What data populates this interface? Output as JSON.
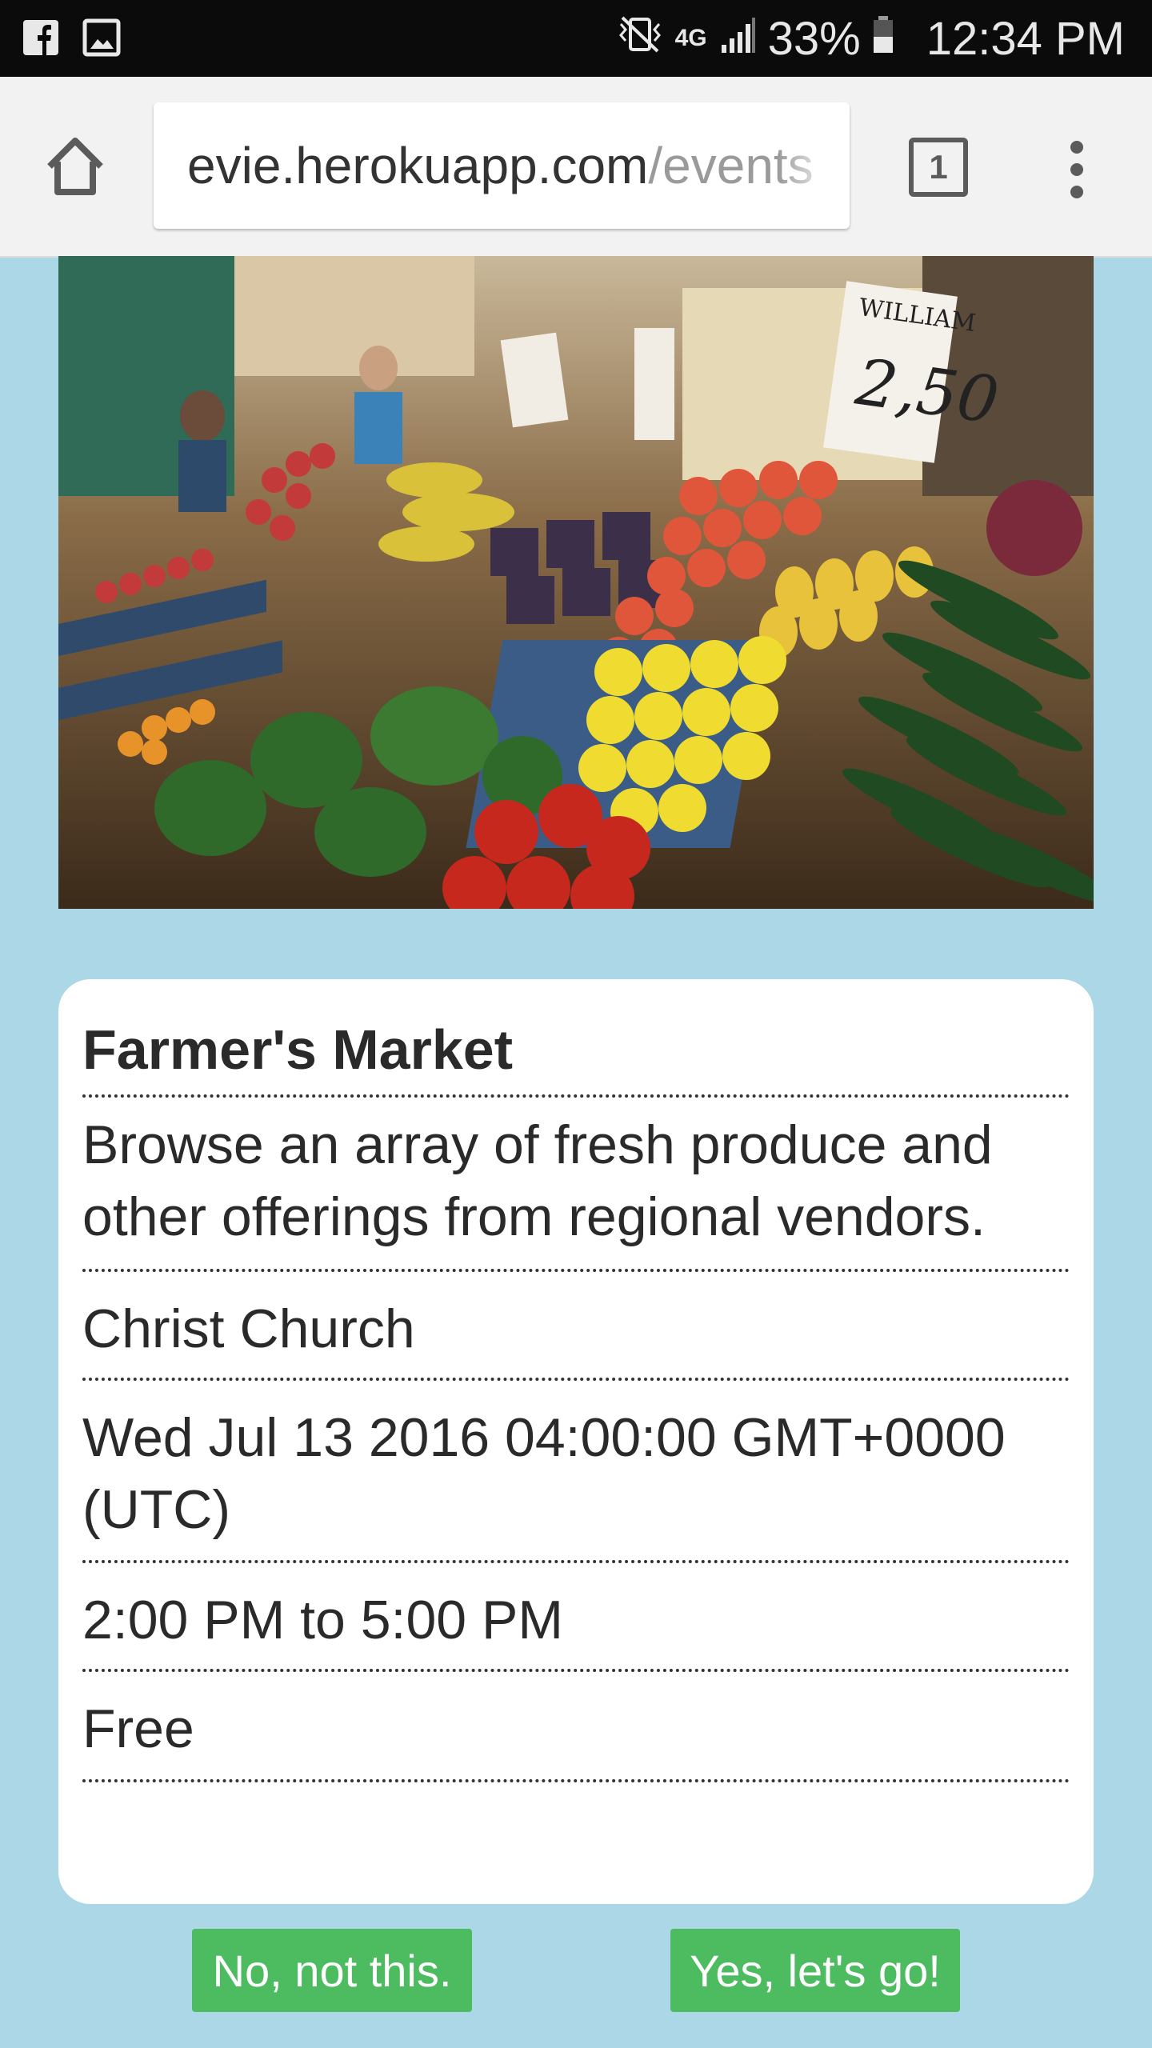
{
  "status_bar": {
    "battery": "33%",
    "network": "4G",
    "time": "12:34 PM"
  },
  "browser": {
    "url_domain": "evie.herokuapp.com",
    "url_path": "/events",
    "tab_count": "1"
  },
  "event": {
    "title": "Farmer's Market",
    "description": "Browse an array of fresh produce and other offerings from regional vendors.",
    "location": "Christ Church",
    "date": "Wed Jul 13 2016 04:00:00 GMT+0000 (UTC)",
    "time": "2:00 PM to 5:00 PM",
    "price": "Free"
  },
  "actions": {
    "reject_label": "No, not this.",
    "accept_label": "Yes, let's go!"
  },
  "icons": {
    "status_left": [
      "facebook-icon",
      "image-icon"
    ],
    "status_right": [
      "vibrate-icon",
      "network-4g-icon",
      "signal-icon",
      "battery-icon"
    ],
    "toolbar": [
      "home-icon",
      "tab-switcher-icon",
      "more-vert-icon"
    ]
  },
  "colors": {
    "background": "#acd7e6",
    "button": "#4dbb5f",
    "card": "#ffffff"
  }
}
